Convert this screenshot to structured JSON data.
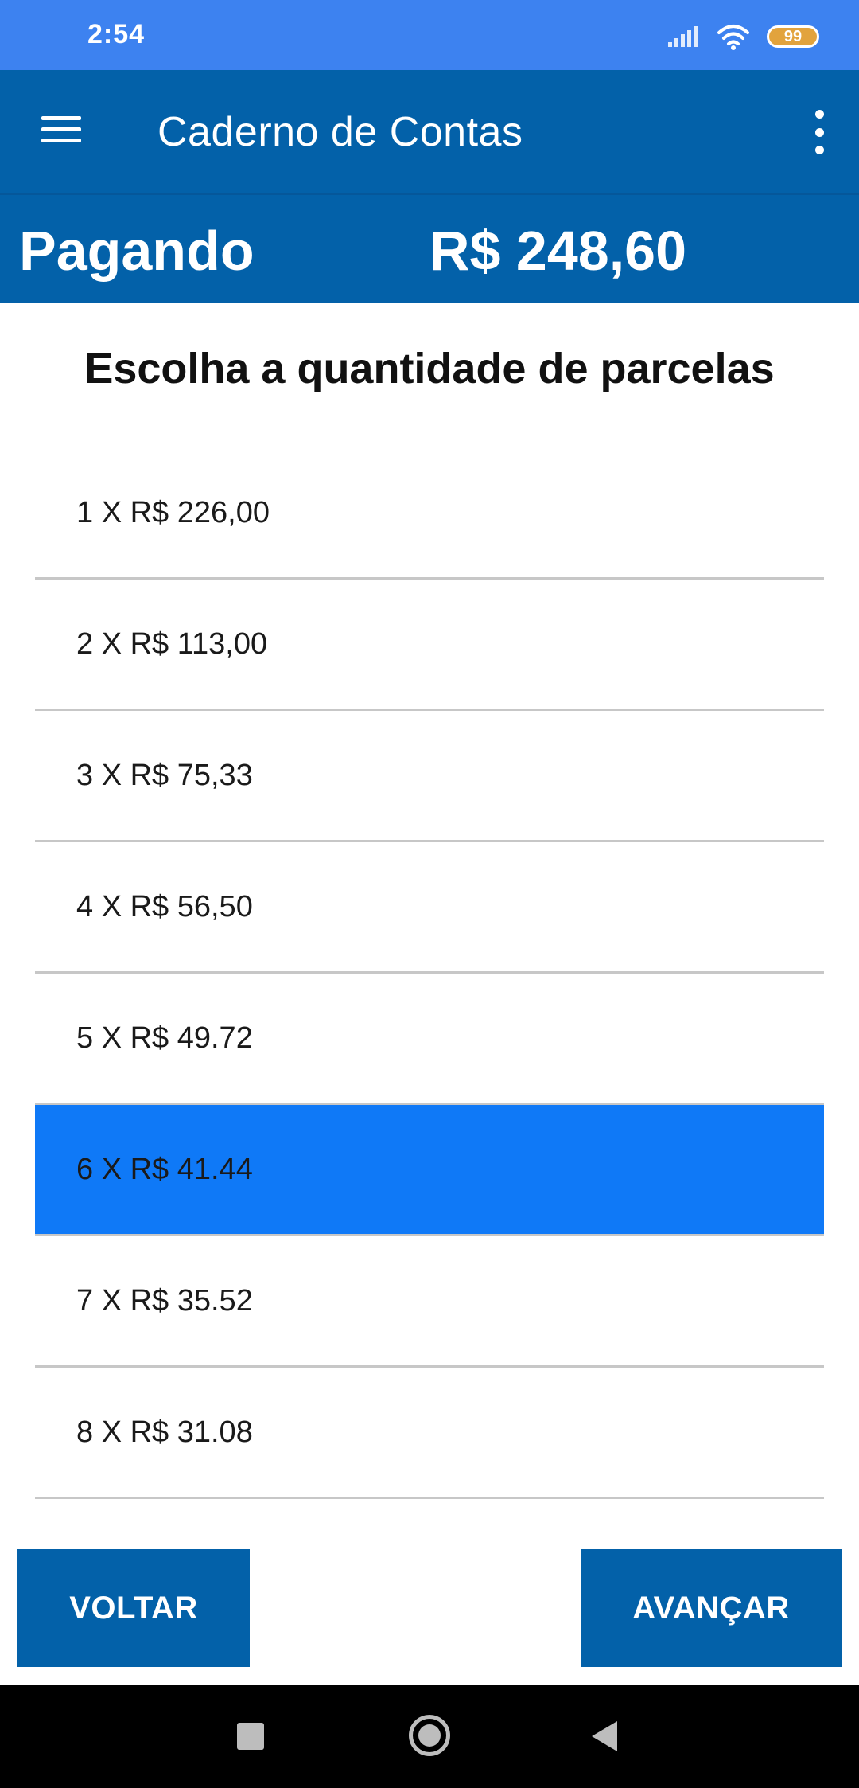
{
  "status_bar": {
    "time": "2:54",
    "battery": "99",
    "icons": [
      "signal-icon",
      "wifi-icon",
      "battery-icon"
    ]
  },
  "app_bar": {
    "title": "Caderno de Contas",
    "menu_icon": "hamburger-menu-icon",
    "overflow_icon": "more-vertical-icon"
  },
  "summary": {
    "label": "Pagando",
    "amount": "R$ 248,60"
  },
  "section_title": "Escolha a quantidade de parcelas",
  "installments": [
    {
      "label": "1 X R$ 226,00",
      "selected": false
    },
    {
      "label": "2 X R$ 113,00",
      "selected": false
    },
    {
      "label": "3 X R$ 75,33",
      "selected": false
    },
    {
      "label": "4 X R$ 56,50",
      "selected": false
    },
    {
      "label": "5 X R$ 49.72",
      "selected": false
    },
    {
      "label": "6 X R$ 41.44",
      "selected": true
    },
    {
      "label": "7 X R$ 35.52",
      "selected": false
    },
    {
      "label": "8 X R$ 31.08",
      "selected": false
    }
  ],
  "buttons": {
    "back": "VOLTAR",
    "next": "AVANÇAR"
  },
  "colors": {
    "status_bar": "#3d82f0",
    "primary": "#0361a9",
    "selected_row": "#0f79f7",
    "divider": "#c7c7c7"
  }
}
